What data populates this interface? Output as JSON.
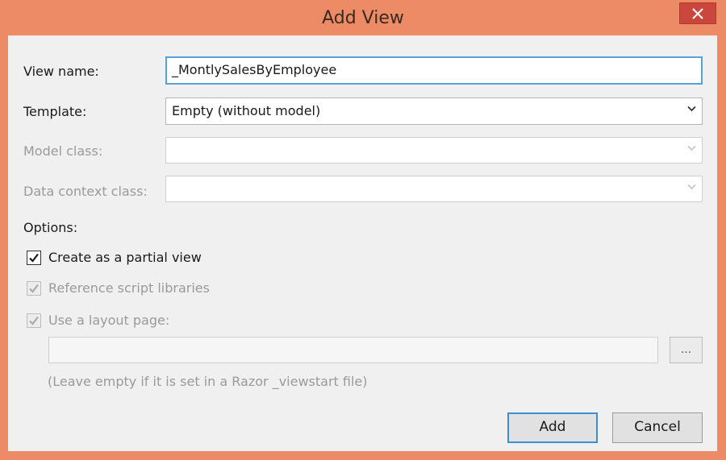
{
  "dialog": {
    "title": "Add View",
    "close_label": "X"
  },
  "form": {
    "view_name_label": "View name:",
    "view_name_value": "_MontlySalesByEmployee",
    "template_label": "Template:",
    "template_value": "Empty (without model)",
    "model_class_label": "Model class:",
    "model_class_value": "",
    "data_context_label": "Data context class:",
    "data_context_value": ""
  },
  "options": {
    "heading": "Options:",
    "partial_view": {
      "label": "Create as a partial view",
      "checked": true,
      "enabled": true
    },
    "reference_scripts": {
      "label": "Reference script libraries",
      "checked": true,
      "enabled": false
    },
    "use_layout": {
      "label": "Use a layout page:",
      "checked": true,
      "enabled": false
    },
    "layout_path_value": "",
    "browse_label": "...",
    "layout_hint": "(Leave empty if it is set in a Razor _viewstart file)"
  },
  "buttons": {
    "add_label": "Add",
    "cancel_label": "Cancel"
  },
  "colors": {
    "frame": "#ec8b65",
    "close": "#c9473d",
    "focus": "#5aa1dc",
    "default_button_border": "#3b8fd6"
  }
}
